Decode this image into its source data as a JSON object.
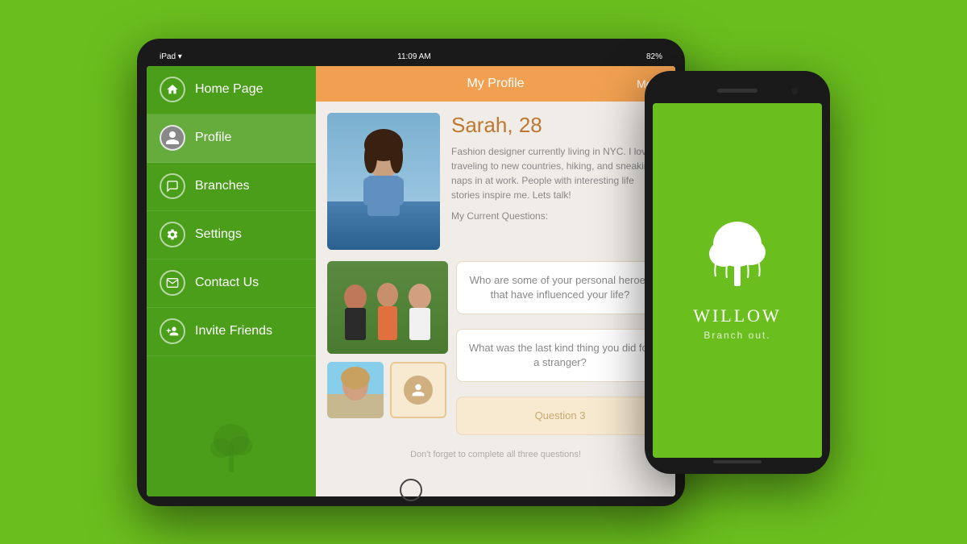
{
  "background_color": "#6abf1e",
  "ipad": {
    "status_bar": {
      "left": "iPad ▾",
      "center": "11:09 AM",
      "right": "82%"
    },
    "sidebar": {
      "items": [
        {
          "id": "home",
          "label": "Home Page",
          "icon": "house"
        },
        {
          "id": "profile",
          "label": "Profile",
          "icon": "person-circle"
        },
        {
          "id": "branches",
          "label": "Branches",
          "icon": "chat-bubble"
        },
        {
          "id": "settings",
          "label": "Settings",
          "icon": "gear"
        },
        {
          "id": "contact",
          "label": "Contact Us",
          "icon": "envelope"
        },
        {
          "id": "invite",
          "label": "Invite Friends",
          "icon": "person-add"
        }
      ]
    },
    "profile": {
      "header_title": "My Profile",
      "header_more": "More",
      "user_name": "Sarah, 28",
      "user_bio": "Fashion designer currently living in NYC. I love traveling to new countries, hiking, and sneaking naps in at work. People with interesting life stories inspire me. Lets talk!",
      "questions_label": "My Current Questions:",
      "questions": [
        {
          "text": "Who are some of your personal heroes that have influenced your life?"
        },
        {
          "text": "What was the last kind thing you did for a stranger?"
        },
        {
          "text": "Question 3",
          "placeholder": true
        }
      ],
      "bottom_note": "Don't forget to complete all three questions!"
    }
  },
  "iphone": {
    "app_name": "WILLOW",
    "app_tagline": "Branch out.",
    "tree_icon": "willow-tree"
  }
}
